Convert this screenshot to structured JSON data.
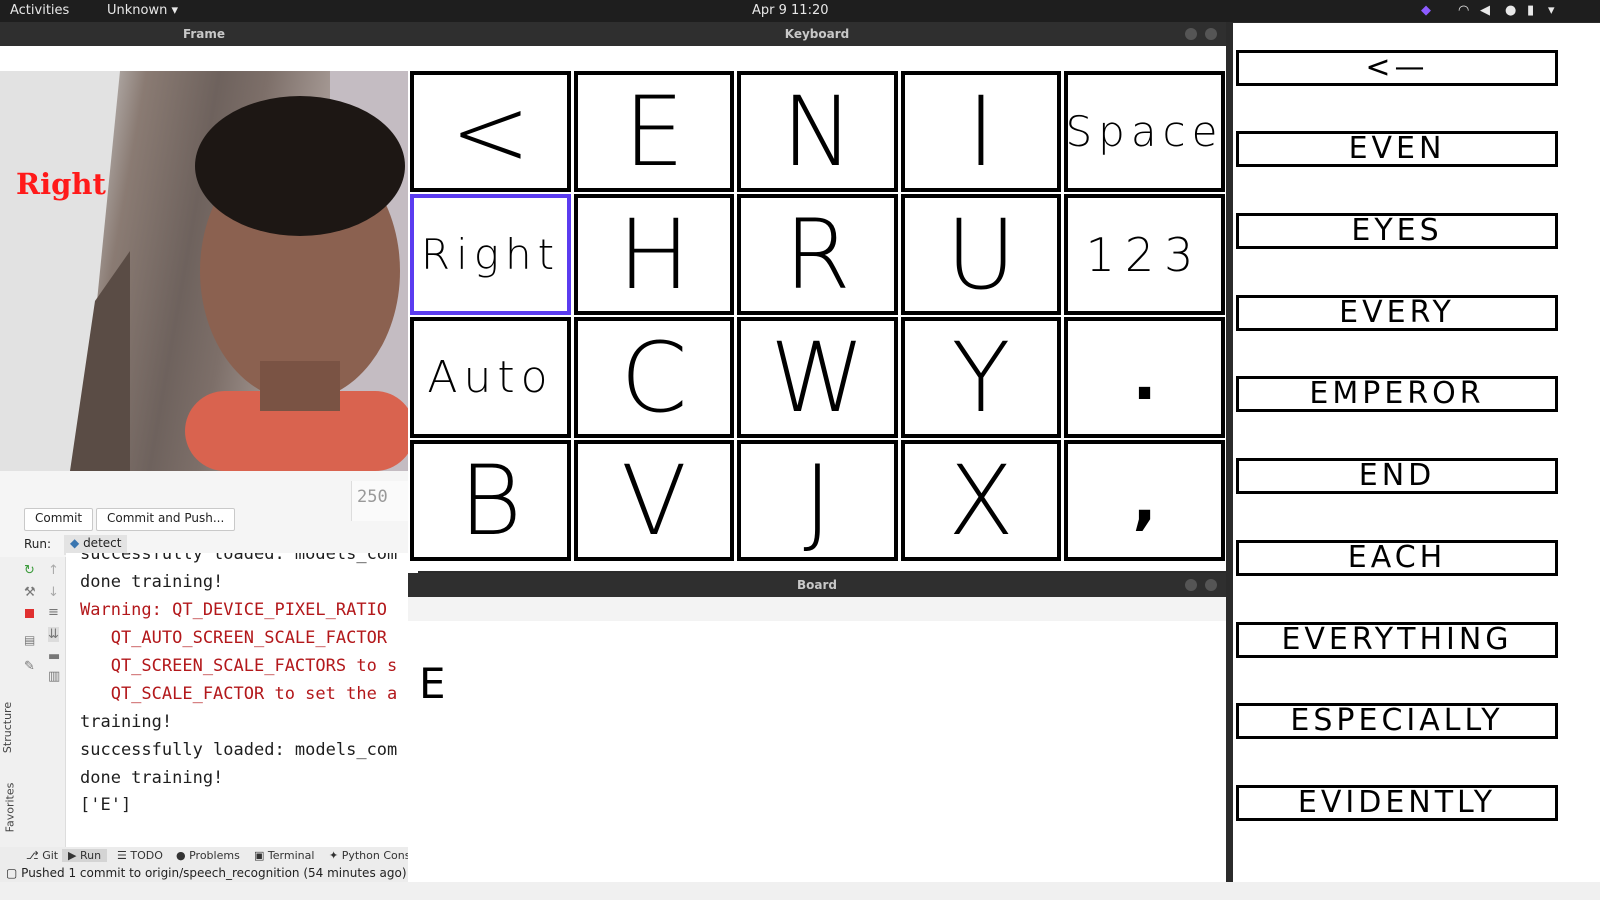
{
  "topbar": {
    "activities": "Activities",
    "app_menu": "Unknown",
    "clock": "Apr 9  11:20"
  },
  "frame_window": {
    "title": "Frame",
    "overlay_text": "Right"
  },
  "ide": {
    "line_number": "250",
    "commit_label": "Commit",
    "commit_push_label": "Commit and Push...",
    "run_label": "Run:",
    "run_config": "detect",
    "console_lines": [
      {
        "text": "successfully loaded: models_com",
        "error": false
      },
      {
        "text": "done training!",
        "error": false
      },
      {
        "text": "Warning: QT_DEVICE_PIXEL_RATIO",
        "error": true
      },
      {
        "text": "   QT_AUTO_SCREEN_SCALE_FACTOR",
        "error": true
      },
      {
        "text": "   QT_SCREEN_SCALE_FACTORS to s",
        "error": true
      },
      {
        "text": "   QT_SCALE_FACTOR to set the a",
        "error": true
      },
      {
        "text": "training!",
        "error": false
      },
      {
        "text": "successfully loaded: models_com",
        "error": false
      },
      {
        "text": "done training!",
        "error": false
      },
      {
        "text": "['E']",
        "error": false
      }
    ],
    "tool_tabs": [
      "Git",
      "Run",
      "TODO",
      "Problems",
      "Terminal",
      "Python Conso"
    ],
    "side_tabs": [
      "Structure",
      "Favorites"
    ],
    "status_message": "Pushed 1 commit to origin/speech_recognition (54 minutes ago)"
  },
  "keyboard_window": {
    "title": "Keyboard",
    "keys": [
      [
        "<",
        "E",
        "N",
        "I",
        "Space"
      ],
      [
        "Right",
        "H",
        "R",
        "U",
        "123"
      ],
      [
        "Auto",
        "C",
        "W",
        "Y",
        "."
      ],
      [
        "B",
        "V",
        "J",
        "X",
        ","
      ]
    ],
    "selected_key": "Right"
  },
  "board_window": {
    "title": "Board",
    "typed_text": "E"
  },
  "suggestions": [
    "<—",
    "EVEN",
    "EYES",
    "EVERY",
    "EMPEROR",
    "END",
    "EACH",
    "EVERYTHING",
    "ESPECIALLY",
    "EVIDENTLY"
  ]
}
